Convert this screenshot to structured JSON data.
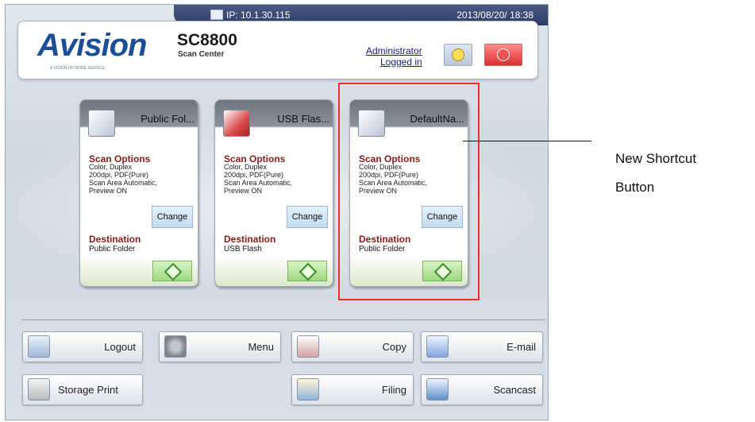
{
  "status_bar": {
    "ip": "IP: 10.1.30.115",
    "datetime": "2013/08/20/ 18:38"
  },
  "header": {
    "brand": "Avision",
    "tagline": "A VISION OF MORE SERVICE",
    "model": "SC8800",
    "subtitle": "Scan Center",
    "admin_line1": "Administrator",
    "admin_line2": "Logged in",
    "power_icon": "power-icon",
    "alert_icon": "alert-icon"
  },
  "shortcuts": [
    {
      "title": "Public Fol...",
      "options_header": "Scan Options",
      "options": "Color, Duplex\n200dpi, PDF(Pure)\nScan Area Automatic,\nPreview ON",
      "change": "Change",
      "dest_header": "Destination",
      "destination": "Public Folder"
    },
    {
      "title": "USB Flas...",
      "options_header": "Scan Options",
      "options": "Color, Duplex\n200dpi, PDF(Pure)\nScan Area Automatic,\nPreview ON",
      "change": "Change",
      "dest_header": "Destination",
      "destination": "USB Flash"
    },
    {
      "title": "DefaultNa...",
      "options_header": "Scan Options",
      "options": "Color, Duplex\n200dpi, PDF(Pure)\nScan Area Automatic,\nPreview ON",
      "change": "Change",
      "dest_header": "Destination",
      "destination": "Public Folder"
    }
  ],
  "bottom_buttons": {
    "logout": "Logout",
    "menu": "Menu",
    "copy": "Copy",
    "email": "E-mail",
    "storage_print": "Storage Print",
    "filing": "Filing",
    "scancast": "Scancast"
  },
  "callout": {
    "line1": "New Shortcut",
    "line2": "Button"
  },
  "colors": {
    "highlight": "#e5312f",
    "section_header": "#8b1a1a",
    "brand": "#1a4e96"
  }
}
